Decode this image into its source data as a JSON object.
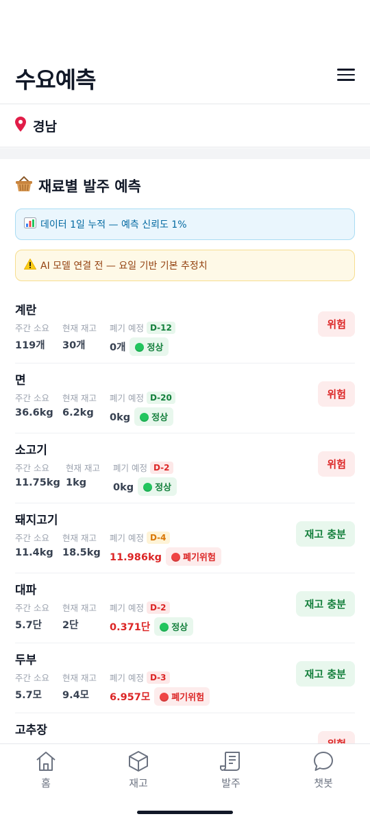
{
  "header": {
    "title": "수요예측",
    "menu_icon": "hamburger-menu-icon"
  },
  "region": {
    "name": "경남",
    "icon": "pin-icon"
  },
  "section": {
    "title": "재료별 발주 예측",
    "icon": "basket-icon"
  },
  "notices": {
    "info": "데이터 1일 누적 — 예측 신뢰도 1%",
    "warn": "AI 모델 연결 전 — 요일 기반 기본 추정치"
  },
  "labels": {
    "weekly": "주간 소요",
    "stock": "현재 재고",
    "waste": "폐기 예정"
  },
  "items": [
    {
      "name": "계란",
      "weekly": "119개",
      "stock": "30개",
      "dday": "D-12",
      "waste": "0개",
      "status": "정상",
      "badge": "위험"
    },
    {
      "name": "면",
      "weekly": "36.6kg",
      "stock": "6.2kg",
      "dday": "D-20",
      "waste": "0kg",
      "status": "정상",
      "badge": "위험"
    },
    {
      "name": "소고기",
      "weekly": "11.75kg",
      "stock": "1kg",
      "dday": "D-2",
      "waste": "0kg",
      "status": "정상",
      "badge": "위험"
    },
    {
      "name": "돼지고기",
      "weekly": "11.4kg",
      "stock": "18.5kg",
      "dday": "D-4",
      "waste": "11.986kg",
      "status": "폐기위험",
      "badge": "재고 충분"
    },
    {
      "name": "대파",
      "weekly": "5.7단",
      "stock": "2단",
      "dday": "D-2",
      "waste": "0.371단",
      "status": "정상",
      "badge": "재고 충분"
    },
    {
      "name": "두부",
      "weekly": "5.7모",
      "stock": "9.4모",
      "dday": "D-3",
      "waste": "6.957모",
      "status": "폐기위험",
      "badge": "재고 충분"
    },
    {
      "name": "고추장",
      "weekly": "",
      "stock": "",
      "dday": "",
      "waste": "",
      "status": "",
      "badge": "위험"
    }
  ],
  "tabs": [
    {
      "label": "홈",
      "icon": "home-icon"
    },
    {
      "label": "재고",
      "icon": "box-icon"
    },
    {
      "label": "발주",
      "icon": "order-icon"
    },
    {
      "label": "챗봇",
      "icon": "chat-icon"
    }
  ],
  "colors": {
    "danger": "#dc2626",
    "ok": "#15803d",
    "info": "#0369a1",
    "warn": "#92400e"
  }
}
